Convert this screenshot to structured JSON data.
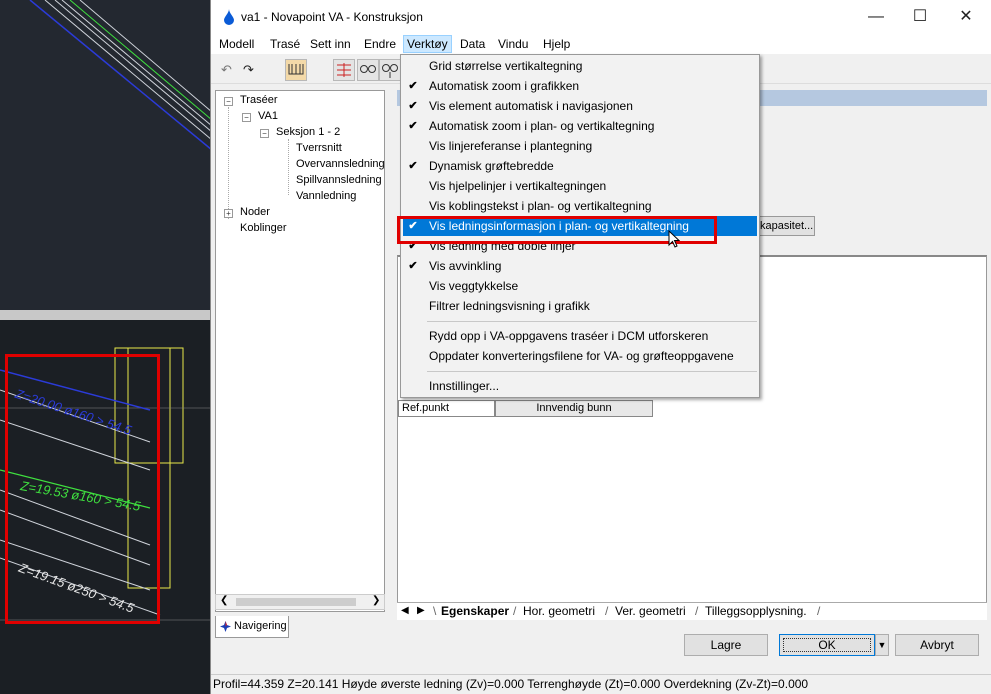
{
  "window": {
    "title": "va1 - Novapoint VA - Konstruksjon",
    "minimize": "—",
    "maximize": "☐",
    "close": "✕"
  },
  "menubar": {
    "items": [
      "Modell",
      "Trasé",
      "Sett inn",
      "Endre",
      "Verktøy",
      "Data",
      "Vindu",
      "Hjelp"
    ],
    "active": "Verktøy"
  },
  "toolbar": {
    "undo": "↶",
    "redo": "↷"
  },
  "nav": {
    "tree": {
      "root": "Traséer",
      "va": "VA1",
      "seksjon": "Seksjon 1 - 2",
      "tverrsnitt": "Tverrsnitt",
      "overvann": "Overvannsledning",
      "spillvann": "Spillvannsledning",
      "vann": "Vannledning",
      "noder": "Noder",
      "koblinger": "Koblinger"
    },
    "tab_label": "Navigering"
  },
  "dropdown": {
    "items": [
      {
        "label": "Grid størrelse vertikaltegning",
        "checked": false
      },
      {
        "label": "Automatisk zoom i grafikken",
        "checked": true
      },
      {
        "label": "Vis element automatisk i navigasjonen",
        "checked": true
      },
      {
        "label": "Automatisk zoom i plan- og vertikaltegning",
        "checked": true
      },
      {
        "label": "Vis linjereferanse i plantegning",
        "checked": false
      },
      {
        "label": "Dynamisk grøftebredde",
        "checked": true
      },
      {
        "label": "Vis hjelpelinjer i vertikaltegningen",
        "checked": false
      },
      {
        "label": "Vis koblingstekst i plan- og vertikaltegning",
        "checked": false
      },
      {
        "label": "Vis ledningsinformasjon i plan- og vertikaltegning",
        "checked": true
      },
      {
        "label": "Vis ledning med doble linjer",
        "checked": true
      },
      {
        "label": "Vis avvinkling",
        "checked": true
      },
      {
        "label": "Vis veggtykkelse",
        "checked": false
      },
      {
        "label": "Filtrer ledningsvisning i grafikk",
        "checked": false
      },
      {
        "label": "Rydd opp i VA-oppgavens traséer i DCM utforskeren",
        "checked": false
      },
      {
        "label": "Oppdater konverteringsfilene for VA- og grøfteoppgavene",
        "checked": false
      },
      {
        "label": "Innstillinger...",
        "checked": false
      }
    ],
    "highlighted_index": 8,
    "check_glyph": "✔"
  },
  "panel": {
    "kapasitet_button": "kapasitet...",
    "refpunkt": "Ref.punkt",
    "innvendig": "Innvendig bunn"
  },
  "tabs": {
    "items": [
      "Egenskaper",
      "Hor. geometri",
      "Ver. geometri",
      "Tilleggsopplysning."
    ],
    "active": "Egenskaper"
  },
  "buttons": {
    "lagre": "Lagre",
    "ok": "OK",
    "ok_dropdown": "▼",
    "avbryt": "Avbryt"
  },
  "status": {
    "text": "Profil=44.359   Z=20.141   Høyde øverste ledning (Zv)=0.000   Terrenghøyde (Zt)=0.000   Overdekning (Zv-Zt)=0.000"
  },
  "cad": {
    "label_blue": "Z=20.00 ø160 > 54.5",
    "label_green": "Z=19.53  ø160 > 54.5",
    "label_white": "Z=19.15  ø250 > 54.5"
  },
  "colors": {
    "highlight": "#0078d7",
    "annotation_red": "#e00000",
    "cad_blue": "#2b3bd8",
    "cad_green": "#3fe03f",
    "cad_yellow": "#e8e84a"
  }
}
